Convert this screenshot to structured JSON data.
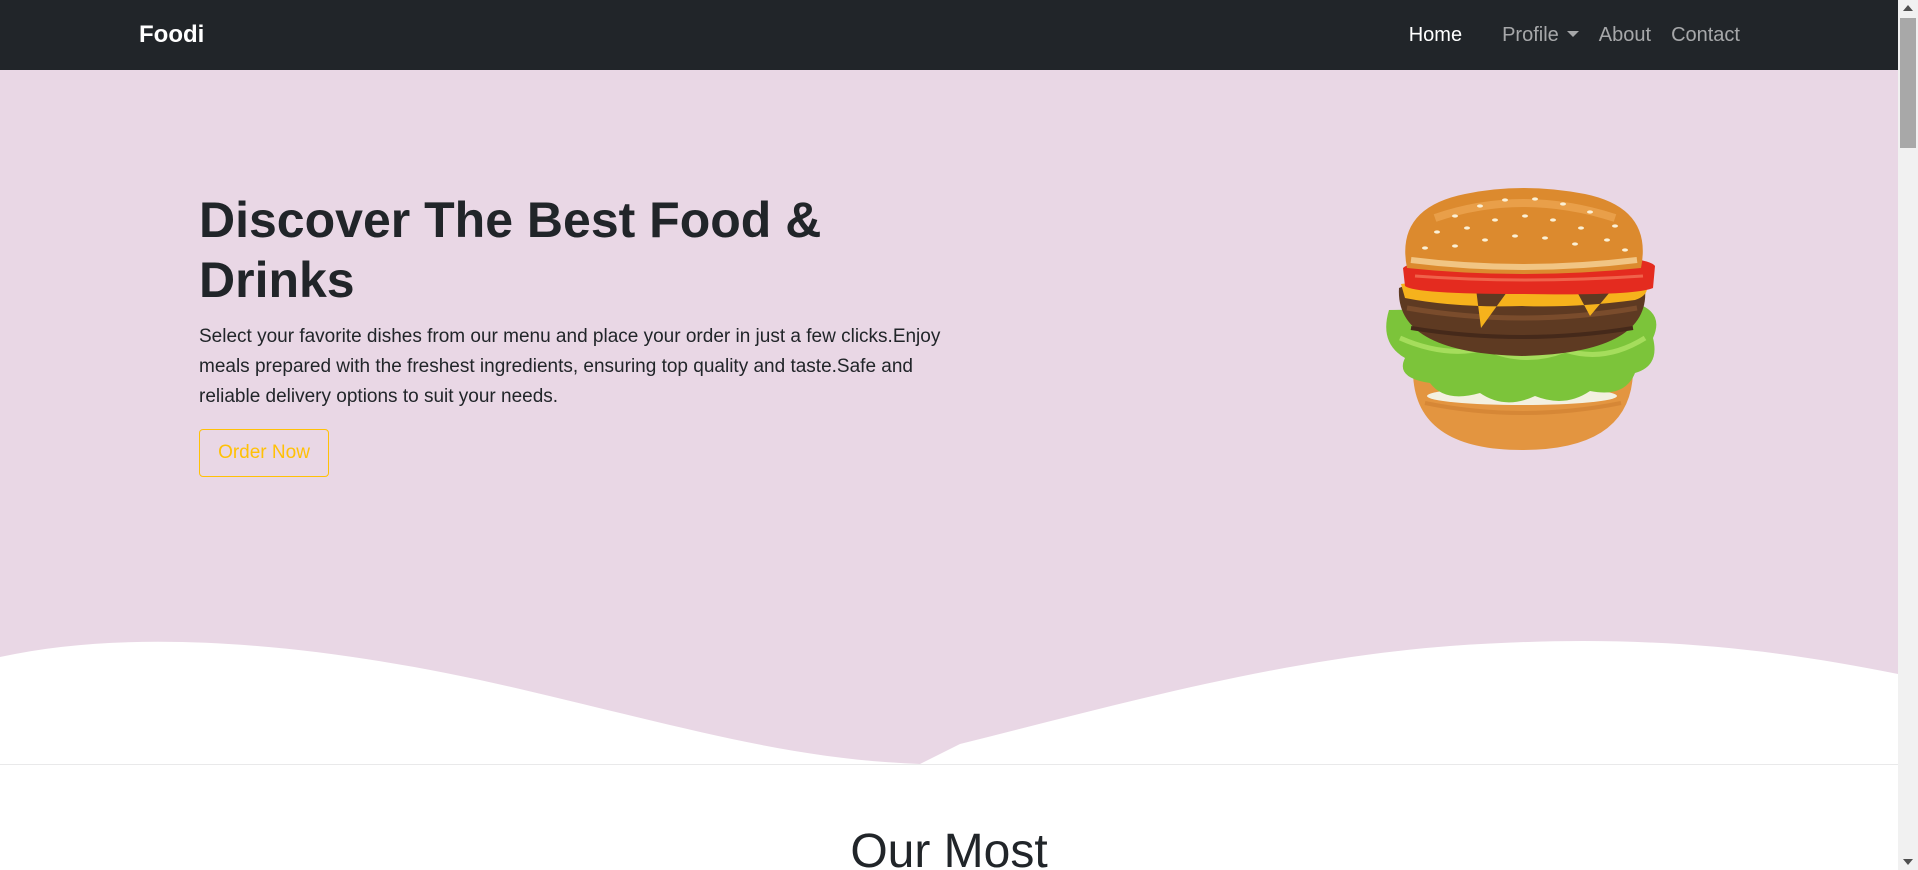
{
  "navbar": {
    "brand": "Foodi",
    "links": [
      {
        "label": "Home",
        "active": true
      },
      {
        "label": "Profile",
        "dropdown": true
      },
      {
        "label": "About"
      },
      {
        "label": "Contact"
      }
    ]
  },
  "hero": {
    "title": "Discover The Best Food & Drinks",
    "description": "Select your favorite dishes from our menu and place your order in just a few clicks.Enjoy meals prepared with the freshest ingredients, ensuring top quality and taste.Safe and reliable delivery options to suit your needs.",
    "cta_label": "Order Now",
    "image": "burger-image"
  },
  "section": {
    "title": "Our Most"
  },
  "colors": {
    "navbar_bg": "#212529",
    "hero_bg": "#e9d7e5",
    "accent": "#ffc107"
  }
}
